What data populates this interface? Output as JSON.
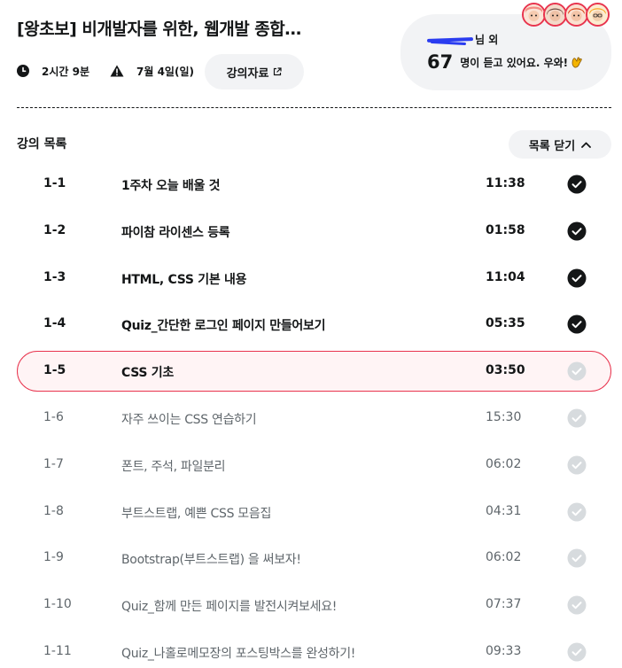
{
  "course": {
    "title": "[왕초보] 비개발자를 위한, 웹개발 종합…",
    "duration": "2시간 9분",
    "date": "7월 4일(일)",
    "materials_label": "강의자료"
  },
  "watchers": {
    "name_suffix": "님 외",
    "count": "67",
    "text": "명이 듣고 있어요. 우와!",
    "icons": [
      "clap-icon"
    ]
  },
  "avatars": [
    {
      "name": "avatar-1",
      "color": "#f28b82"
    },
    {
      "name": "avatar-2",
      "color": "#6d4c41"
    },
    {
      "name": "avatar-3",
      "color": "#d84315"
    },
    {
      "name": "avatar-4",
      "color": "#f9a825"
    }
  ],
  "lesson_list": {
    "heading": "강의 목록",
    "close_label": "목록 닫기",
    "items": [
      {
        "num": "1-1",
        "title": "1주차 오늘 배울 것",
        "time": "11:38",
        "status": "done"
      },
      {
        "num": "1-2",
        "title": "파이참 라이센스 등록",
        "time": "01:58",
        "status": "done"
      },
      {
        "num": "1-3",
        "title": "HTML, CSS 기본 내용",
        "time": "11:04",
        "status": "done"
      },
      {
        "num": "1-4",
        "title": "Quiz_간단한 로그인 페이지 만들어보기",
        "time": "05:35",
        "status": "done"
      },
      {
        "num": "1-5",
        "title": "CSS 기초",
        "time": "03:50",
        "status": "active"
      },
      {
        "num": "1-6",
        "title": "자주 쓰이는 CSS 연습하기",
        "time": "15:30",
        "status": "pending"
      },
      {
        "num": "1-7",
        "title": "폰트, 주석, 파일분리",
        "time": "06:02",
        "status": "pending"
      },
      {
        "num": "1-8",
        "title": "부트스트랩, 예쁜 CSS 모음집",
        "time": "04:31",
        "status": "pending"
      },
      {
        "num": "1-9",
        "title": "Bootstrap(부트스트랩) 을 써보자!",
        "time": "06:02",
        "status": "pending"
      },
      {
        "num": "1-10",
        "title": "Quiz_함께 만든 페이지를 발전시켜보세요!",
        "time": "07:37",
        "status": "pending"
      },
      {
        "num": "1-11",
        "title": "Quiz_나홀로메모장의 포스팅박스를 완성하기!",
        "time": "09:33",
        "status": "pending"
      }
    ]
  },
  "colors": {
    "accent": "#e8344e",
    "active_bg": "#fff4f5",
    "check_done": "#141617",
    "check_pending": "#d7dbde",
    "pill_bg": "#f2f3f5"
  }
}
